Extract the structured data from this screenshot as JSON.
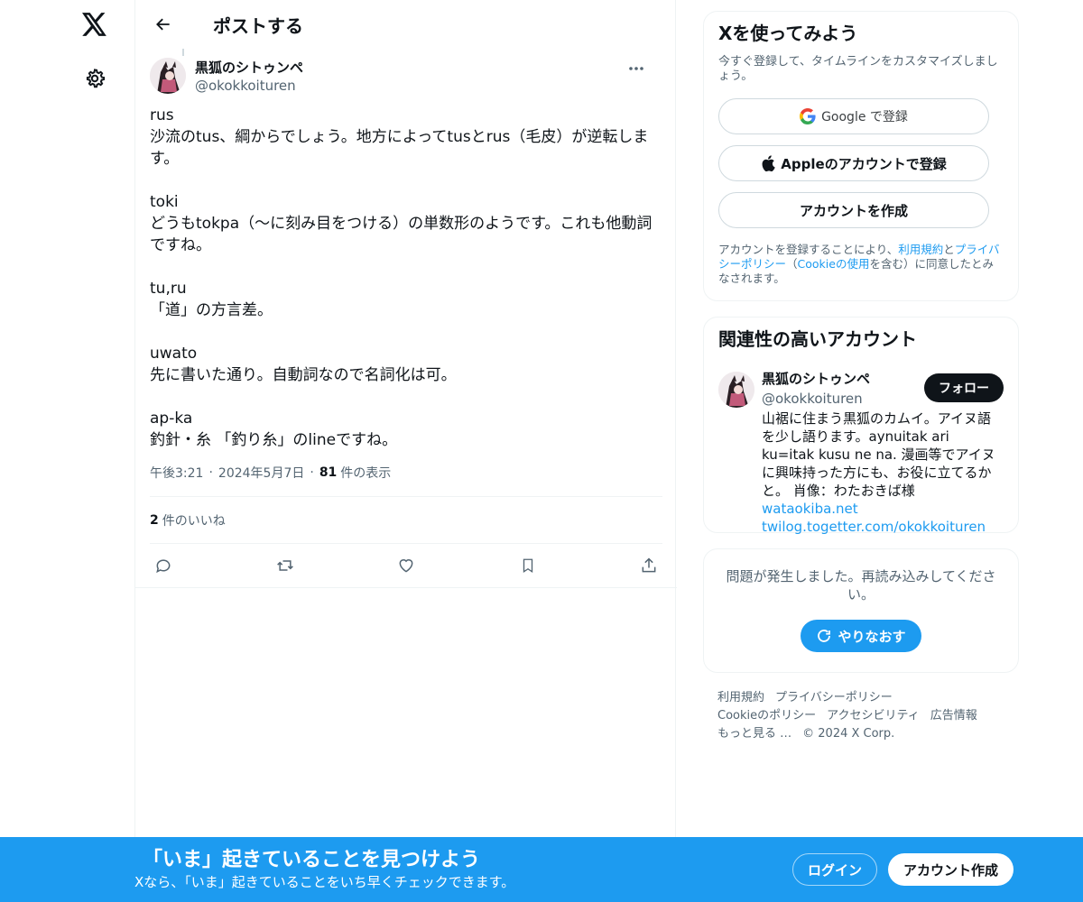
{
  "nav": {
    "logo_icon": "x-logo-icon",
    "settings_icon": "gear-icon"
  },
  "header": {
    "title": "ポストする"
  },
  "post": {
    "author": {
      "display_name": "黒狐のシトゥンペ",
      "handle": "@okokkoituren"
    },
    "text_lines": [
      "rus",
      "沙流のtus、綱からでしょう。地方によってtusとrus（毛皮）が逆転しま",
      "す。",
      "",
      "toki",
      "どうもtokpa（〜に刻み目をつける）の単数形のようです。これも他動詞",
      "ですね。",
      "",
      "tu,ru",
      "「道」の方言差。",
      "",
      "uwato",
      "先に書いた通り。自動詞なので名詞化は可。",
      "",
      "ap-ka",
      "釣針・糸 「釣り糸」のlineですね。"
    ],
    "time": "午後3:21",
    "date": "2024年5月7日",
    "views_count": "81",
    "views_label": "件の表示",
    "likes_count": "2",
    "likes_label": "件のいいね"
  },
  "signup_card": {
    "title": "Xを使ってみよう",
    "subtitle": "今すぐ登録して、タイムラインをカスタマイズしましょう。",
    "google_button": "Google で登録",
    "apple_button": "Appleのアカウントで登録",
    "create_button": "アカウントを作成",
    "legal_prefix": "アカウントを登録することにより、",
    "terms_link": "利用規約",
    "and": "と",
    "privacy_link": "プライバシーポリシー",
    "paren_open": "（",
    "cookie_link": "Cookieの使用",
    "legal_suffix": "を含む）に同意したとみなされます。"
  },
  "related_card": {
    "title": "関連性の高いアカウント",
    "name": "黒狐のシトゥンペ",
    "handle": "@okokkoituren",
    "follow_button": "フォロー",
    "bio": "山裾に住まう黒狐のカムイ。アイヌ語を少し語ります。aynuitak ari ku=itak kusu ne na. 漫画等でアイヌに興味持った方にも、お役に立てるかと。 肖像：わたおきば様 ",
    "bio_link1": "wataokiba.net",
    "bio_link2": "twilog.togetter.com/okokkoituren"
  },
  "error_card": {
    "message": "問題が発生しました。再読み込みしてください。",
    "retry_button": "やりなおす"
  },
  "footer": {
    "links": [
      "利用規約",
      "プライバシーポリシー",
      "Cookieのポリシー",
      "アクセシビリティ",
      "広告情報",
      "もっと見る …",
      "© 2024 X Corp."
    ]
  },
  "bottom_bar": {
    "title": "「いま」起きていることを見つけよう",
    "subtitle": "Xなら、「いま」起きていることをいち早くチェックできます。",
    "login_button": "ログイン",
    "signup_button": "アカウント作成"
  },
  "colors": {
    "accent": "#1d9bf0",
    "text": "#0f1419",
    "secondary_text": "#536471",
    "border": "#eff3f4"
  }
}
